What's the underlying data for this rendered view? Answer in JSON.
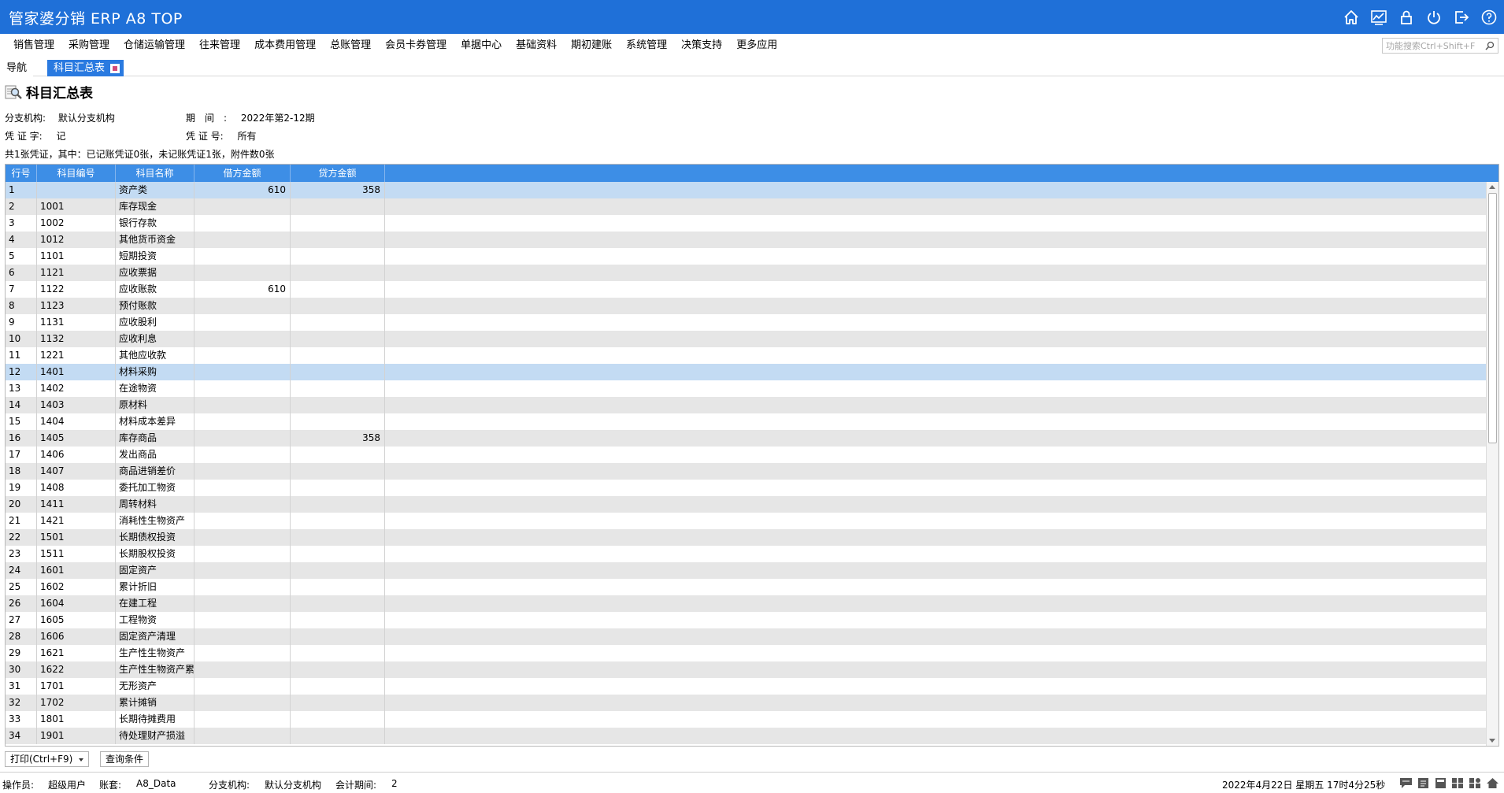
{
  "app": {
    "title": "管家婆分销 ERP A8 TOP",
    "window_icons": [
      "home-icon",
      "chart-icon",
      "lock-icon",
      "power-icon",
      "exit-icon",
      "help-icon"
    ]
  },
  "menu": {
    "items": [
      "销售管理",
      "采购管理",
      "仓储运输管理",
      "往来管理",
      "成本费用管理",
      "总账管理",
      "会员卡券管理",
      "单据中心",
      "基础资料",
      "期初建账",
      "系统管理",
      "决策支持",
      "更多应用"
    ],
    "search_placeholder": "功能搜索Ctrl+Shift+F"
  },
  "tabs": {
    "nav": "导航",
    "active": "科目汇总表"
  },
  "page": {
    "title": "科目汇总表",
    "branch_label": "分支机构:",
    "branch_value": "默认分支机构",
    "period_label": "期　间　:",
    "period_value": "2022年第2-12期",
    "voucher_word_label": "凭 证 字:",
    "voucher_word_value": "记",
    "voucher_no_label": "凭 证 号:",
    "voucher_no_value": "所有",
    "summary": "共1张凭证，其中：已记账凭证0张，未记账凭证1张，附件数0张"
  },
  "table": {
    "columns": [
      "行号",
      "科目编号",
      "科目名称",
      "借方金额",
      "贷方金额"
    ],
    "rows": [
      [
        "1",
        "",
        "资产类",
        "610",
        "358"
      ],
      [
        "2",
        "1001",
        "库存现金",
        "",
        ""
      ],
      [
        "3",
        "1002",
        "银行存款",
        "",
        ""
      ],
      [
        "4",
        "1012",
        "其他货币资金",
        "",
        ""
      ],
      [
        "5",
        "1101",
        "短期投资",
        "",
        ""
      ],
      [
        "6",
        "1121",
        "应收票据",
        "",
        ""
      ],
      [
        "7",
        "1122",
        "应收账款",
        "610",
        ""
      ],
      [
        "8",
        "1123",
        "预付账款",
        "",
        ""
      ],
      [
        "9",
        "1131",
        "应收股利",
        "",
        ""
      ],
      [
        "10",
        "1132",
        "应收利息",
        "",
        ""
      ],
      [
        "11",
        "1221",
        "其他应收款",
        "",
        ""
      ],
      [
        "12",
        "1401",
        "材料采购",
        "",
        ""
      ],
      [
        "13",
        "1402",
        "在途物资",
        "",
        ""
      ],
      [
        "14",
        "1403",
        "原材料",
        "",
        ""
      ],
      [
        "15",
        "1404",
        "材料成本差异",
        "",
        ""
      ],
      [
        "16",
        "1405",
        "库存商品",
        "",
        "358"
      ],
      [
        "17",
        "1406",
        "发出商品",
        "",
        ""
      ],
      [
        "18",
        "1407",
        "商品进销差价",
        "",
        ""
      ],
      [
        "19",
        "1408",
        "委托加工物资",
        "",
        ""
      ],
      [
        "20",
        "1411",
        "周转材料",
        "",
        ""
      ],
      [
        "21",
        "1421",
        "消耗性生物资产",
        "",
        ""
      ],
      [
        "22",
        "1501",
        "长期债权投资",
        "",
        ""
      ],
      [
        "23",
        "1511",
        "长期股权投资",
        "",
        ""
      ],
      [
        "24",
        "1601",
        "固定资产",
        "",
        ""
      ],
      [
        "25",
        "1602",
        "累计折旧",
        "",
        ""
      ],
      [
        "26",
        "1604",
        "在建工程",
        "",
        ""
      ],
      [
        "27",
        "1605",
        "工程物资",
        "",
        ""
      ],
      [
        "28",
        "1606",
        "固定资产清理",
        "",
        ""
      ],
      [
        "29",
        "1621",
        "生产性生物资产",
        "",
        ""
      ],
      [
        "30",
        "1622",
        "生产性生物资产累",
        "",
        ""
      ],
      [
        "31",
        "1701",
        "无形资产",
        "",
        ""
      ],
      [
        "32",
        "1702",
        "累计摊销",
        "",
        ""
      ],
      [
        "33",
        "1801",
        "长期待摊费用",
        "",
        ""
      ],
      [
        "34",
        "1901",
        "待处理财产损溢",
        "",
        ""
      ]
    ],
    "selected_rows": [
      1,
      12
    ]
  },
  "buttons": {
    "print": "打印(Ctrl+F9)",
    "query": "查询条件"
  },
  "status": {
    "operator_label": "操作员:",
    "operator_value": "超级用户",
    "account_label": "账套:",
    "account_value": "A8_Data",
    "branch_label": "分支机构:",
    "branch_value": "默认分支机构",
    "period_label": "会计期间:",
    "period_value": "2",
    "datetime": "2022年4月22日  星期五  17时4分25秒",
    "icons": [
      "message-icon",
      "notepad-icon",
      "calculator-icon",
      "grid-icon",
      "apps-icon",
      "home-icon"
    ]
  },
  "colors": {
    "titlebar": "#1f70d8",
    "grid_header": "#3d8ee6",
    "selected_row": "#c3dbf3",
    "alt_row": "#e6e6e6"
  }
}
